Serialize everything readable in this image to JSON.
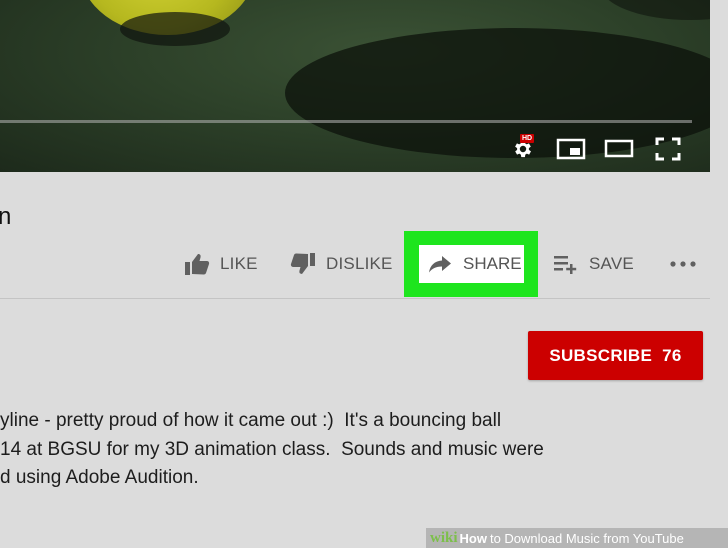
{
  "player": {
    "controls": [
      "settings-icon",
      "miniplayer-icon",
      "theater-mode-icon",
      "fullscreen-icon"
    ],
    "hd_badge": "HD"
  },
  "video": {
    "title_fragment": "n"
  },
  "actions": {
    "like": "LIKE",
    "dislike": "DISLIKE",
    "share": "SHARE",
    "save": "SAVE",
    "more_icon": "more-horizontal-icon"
  },
  "highlight_color": "#1ee51e",
  "subscribe": {
    "label": "SUBSCRIBE",
    "count": "76",
    "color": "#cc0000"
  },
  "description": {
    "lines": [
      "yline - pretty proud of how it came out :)  It's a bouncing ball",
      "14 at BGSU for my 3D animation class.  Sounds and music were",
      "d using Adobe Audition."
    ]
  },
  "watermark": {
    "wiki": "wiki",
    "how": "How",
    "text": "to Download Music from YouTube"
  }
}
